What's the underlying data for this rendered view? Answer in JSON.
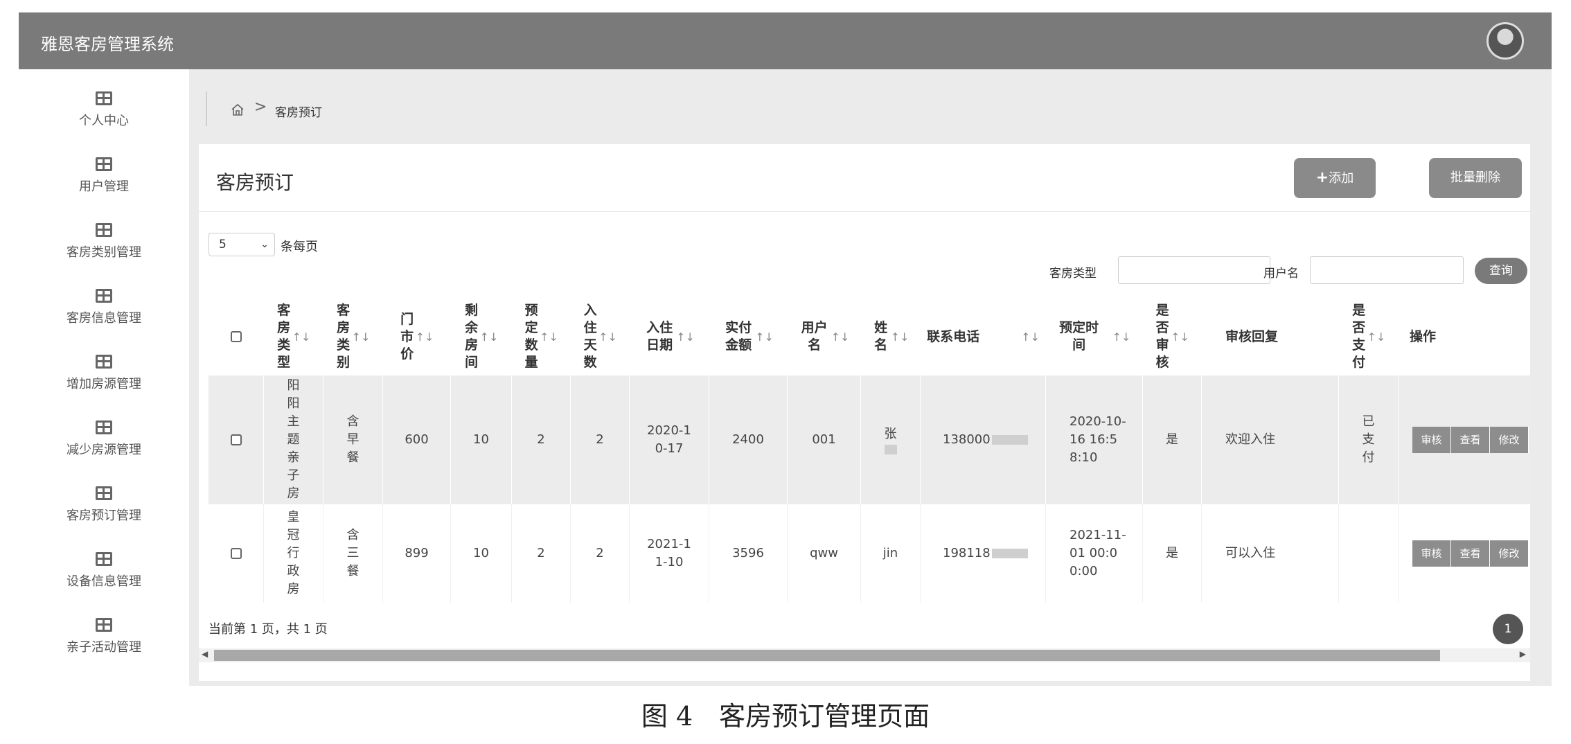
{
  "app": {
    "title": "雅恩客房管理系统"
  },
  "sidebar": {
    "items": [
      {
        "label": "个人中心"
      },
      {
        "label": "用户管理"
      },
      {
        "label": "客房类别管理"
      },
      {
        "label": "客房信息管理"
      },
      {
        "label": "增加房源管理"
      },
      {
        "label": "减少房源管理"
      },
      {
        "label": "客房预订管理"
      },
      {
        "label": "设备信息管理"
      },
      {
        "label": "亲子活动管理"
      }
    ]
  },
  "breadcrumb": {
    "separator": ">",
    "current": "客房预订"
  },
  "panel": {
    "title": "客房预订",
    "add_label": "添加",
    "batch_delete_label": "批量删除"
  },
  "page_size": {
    "value": "5",
    "label": "条每页"
  },
  "search": {
    "room_type_label": "客房类型",
    "room_type_value": "",
    "username_label": "用户名",
    "username_value": "",
    "query_label": "查询"
  },
  "table": {
    "sort_icon": "↑↓",
    "headers": [
      "客房类型",
      "客房类别",
      "门市价",
      "剩余房间",
      "预定数量",
      "入住天数",
      "入住日期",
      "实付金额",
      "用户名",
      "姓名",
      "联系电话",
      "预定时间",
      "是否审核",
      "审核回复",
      "是否支付",
      "操作"
    ],
    "rows": [
      {
        "room_type": "阳阳主题亲子房",
        "room_category": "含早餐",
        "price": "600",
        "remaining": "10",
        "quantity": "2",
        "days": "2",
        "checkin_date": "2020-10-17",
        "paid": "2400",
        "username": "001",
        "name": "张",
        "phone": "138000",
        "booking_time": "2020-10-16 16:58:10",
        "reviewed": "是",
        "reply": "欢迎入住",
        "payment": "已支付"
      },
      {
        "room_type": "皇冠行政房",
        "room_category": "含三餐",
        "price": "899",
        "remaining": "10",
        "quantity": "2",
        "days": "2",
        "checkin_date": "2021-11-10",
        "paid": "3596",
        "username": "qww",
        "name": "jin",
        "phone": "198118",
        "booking_time": "2021-11-01 00:00:00",
        "reviewed": "是",
        "reply": "可以入住",
        "payment": ""
      }
    ],
    "actions": [
      "审核",
      "查看",
      "修改"
    ]
  },
  "pagination": {
    "text": "当前第 1 页，共 1 页",
    "current_page": "1"
  },
  "caption": "图 4　客房预订管理页面"
}
